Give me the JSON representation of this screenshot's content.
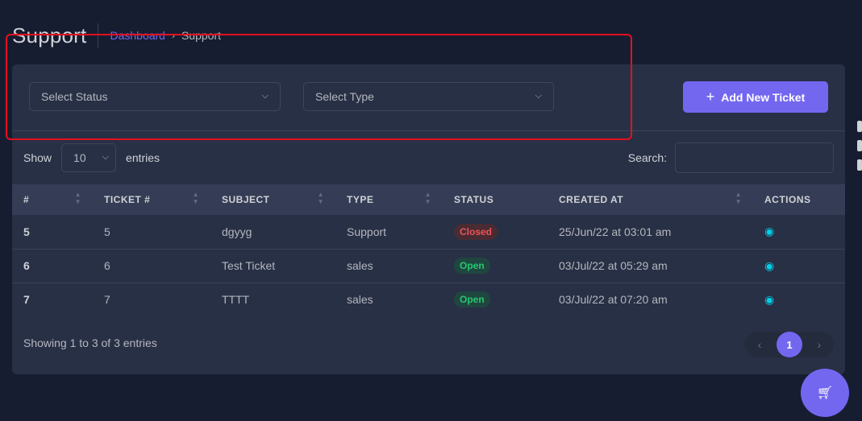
{
  "header": {
    "title": "Support",
    "breadcrumb": {
      "link": "Dashboard",
      "current": "Support"
    }
  },
  "filters": {
    "status_placeholder": "Select Status",
    "type_placeholder": "Select Type",
    "add_button": "Add New Ticket"
  },
  "table_controls": {
    "show_label": "Show",
    "page_length": "10",
    "entries_label": "entries",
    "search_label": "Search:"
  },
  "table": {
    "columns": [
      "#",
      "TICKET #",
      "SUBJECT",
      "TYPE",
      "STATUS",
      "CREATED AT",
      "ACTIONS"
    ],
    "rows": [
      {
        "id": "5",
        "ticket": "5",
        "subject": "dgyyg",
        "type": "Support",
        "status": "Closed",
        "created": "25/Jun/22 at 03:01 am"
      },
      {
        "id": "6",
        "ticket": "6",
        "subject": "Test Ticket",
        "type": "sales",
        "status": "Open",
        "created": "03/Jul/22 at 05:29 am"
      },
      {
        "id": "7",
        "ticket": "7",
        "subject": "TTTT",
        "type": "sales",
        "status": "Open",
        "created": "03/Jul/22 at 07:20 am"
      }
    ]
  },
  "footer": {
    "info": "Showing 1 to 3 of 3 entries",
    "current_page": "1"
  },
  "colors": {
    "primary": "#7367f0",
    "background": "#161d31",
    "card": "#283046",
    "highlight": "#e4101e"
  },
  "icons": {
    "chevron": "chevron-down-icon",
    "plus": "plus-icon",
    "view": "eye-icon",
    "cart": "cart-icon"
  }
}
